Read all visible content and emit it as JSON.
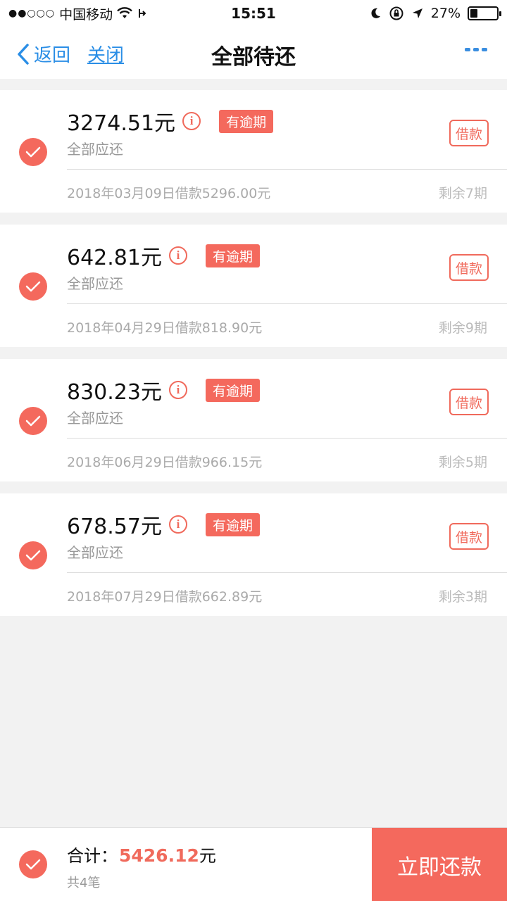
{
  "status_bar": {
    "carrier": "中国移动",
    "time": "15:51",
    "battery": "27%",
    "battery_level": 0.27
  },
  "nav": {
    "back_label": "返回",
    "close_label": "关闭",
    "title": "全部待还"
  },
  "loans": [
    {
      "amount": "3274.51元",
      "badge": "有逾期",
      "sub": "全部应还",
      "type": "借款",
      "info": "2018年03月09日借款5296.00元",
      "remain": "剩余7期"
    },
    {
      "amount": "642.81元",
      "badge": "有逾期",
      "sub": "全部应还",
      "type": "借款",
      "info": "2018年04月29日借款818.90元",
      "remain": "剩余9期"
    },
    {
      "amount": "830.23元",
      "badge": "有逾期",
      "sub": "全部应还",
      "type": "借款",
      "info": "2018年06月29日借款966.15元",
      "remain": "剩余5期"
    },
    {
      "amount": "678.57元",
      "badge": "有逾期",
      "sub": "全部应还",
      "type": "借款",
      "info": "2018年07月29日借款662.89元",
      "remain": "剩余3期"
    }
  ],
  "footer": {
    "total_label": "合计：",
    "total_value": "5426.12",
    "total_unit": "元",
    "count": "共4笔",
    "pay_label": "立即还款"
  },
  "colors": {
    "accent": "#f4695d",
    "link": "#2a8ee6"
  },
  "icons": {
    "info": "i",
    "check": "check-icon"
  }
}
